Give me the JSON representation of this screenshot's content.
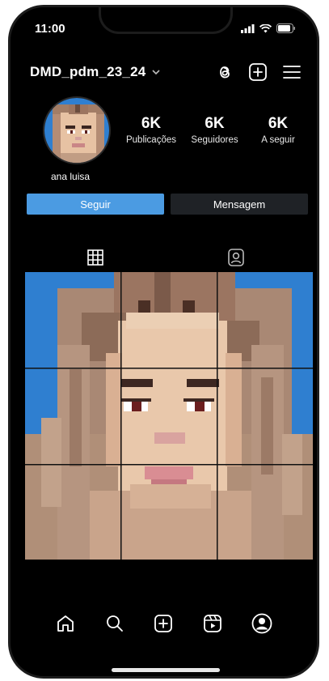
{
  "status_bar": {
    "time": "11:00"
  },
  "header": {
    "username": "DMD_pdm_23_24"
  },
  "profile": {
    "display_name": "ana luisa",
    "stats": [
      {
        "value": "6K",
        "label": "Publicações"
      },
      {
        "value": "6K",
        "label": "Seguidores"
      },
      {
        "value": "6K",
        "label": "A seguir"
      }
    ]
  },
  "actions": {
    "follow_label": "Seguir",
    "message_label": "Mensagem"
  },
  "tabs": [
    {
      "icon": "grid-icon",
      "active": true
    },
    {
      "icon": "tagged-icon",
      "active": false
    }
  ],
  "nav": [
    "home-icon",
    "search-icon",
    "create-icon",
    "reels-icon",
    "profile-icon"
  ],
  "colors": {
    "background": "#000000",
    "follow_button": "#4b9be2",
    "message_button": "#1f2226",
    "image_background": "#2f7fd0"
  }
}
